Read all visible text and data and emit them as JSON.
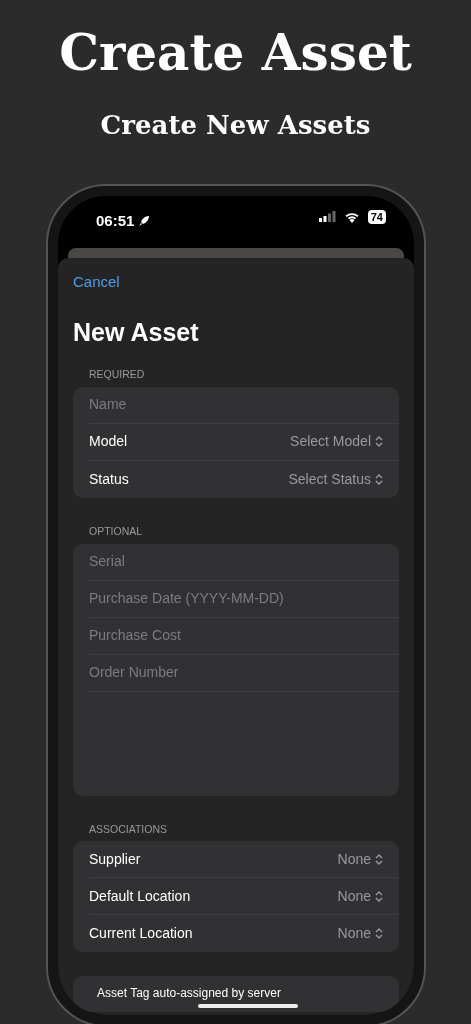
{
  "header": {
    "title": "Create Asset",
    "subtitle": "Create New Assets"
  },
  "status_bar": {
    "time": "06:51",
    "battery": "74"
  },
  "nav": {
    "cancel": "Cancel",
    "title": "New Asset"
  },
  "sections": [
    {
      "header": "REQUIRED",
      "rows": [
        {
          "kind": "field",
          "placeholder": "Name"
        },
        {
          "kind": "picker",
          "label": "Model",
          "value": "Select Model"
        },
        {
          "kind": "picker",
          "label": "Status",
          "value": "Select Status"
        }
      ]
    },
    {
      "header": "OPTIONAL",
      "rows": [
        {
          "kind": "field",
          "placeholder": "Serial"
        },
        {
          "kind": "field",
          "placeholder": "Purchase Date (YYYY-MM-DD)"
        },
        {
          "kind": "field",
          "placeholder": "Purchase Cost"
        },
        {
          "kind": "field",
          "placeholder": "Order Number"
        },
        {
          "kind": "notes"
        }
      ]
    },
    {
      "header": "ASSOCIATIONS",
      "rows": [
        {
          "kind": "picker",
          "label": "Supplier",
          "value": "None"
        },
        {
          "kind": "picker",
          "label": "Default Location",
          "value": "None"
        },
        {
          "kind": "picker",
          "label": "Current Location",
          "value": "None"
        }
      ]
    }
  ],
  "footer": "Asset Tag auto-assigned by server"
}
